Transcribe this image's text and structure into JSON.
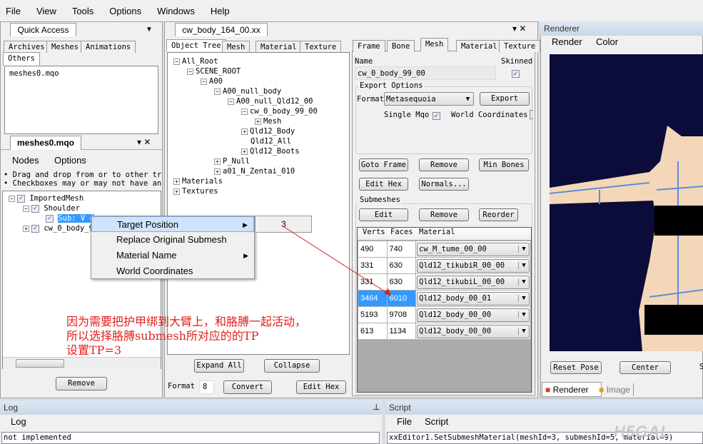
{
  "menu": [
    "File",
    "View",
    "Tools",
    "Options",
    "Windows",
    "Help"
  ],
  "quick_access": {
    "title": "Quick Access",
    "tabs": [
      "Archives",
      "Meshes",
      "Animations",
      "Others"
    ],
    "selected_tab": "Others",
    "items": [
      "meshes0.mqo"
    ]
  },
  "mesh_panel": {
    "title": "meshes0.mqo",
    "menu": [
      "Nodes",
      "Options"
    ],
    "hints": [
      "• Drag and drop from or to other tree",
      "• Checkboxes may or may not have an e"
    ],
    "tree": [
      {
        "label": "ImportedMesh",
        "level": 0,
        "checked": true,
        "expander": "-"
      },
      {
        "label": "Shoulder",
        "level": 1,
        "checked": true,
        "expander": "-"
      },
      {
        "label": "Sub: V 4",
        "level": 2,
        "checked": true,
        "expander": "",
        "selected": true
      },
      {
        "label": "cw_0_body_9",
        "level": 1,
        "checked": true,
        "expander": "+"
      }
    ],
    "remove_label": "Remove"
  },
  "context_menu": {
    "items": [
      {
        "label": "Target Position",
        "submenu": true,
        "highlighted": true
      },
      {
        "label": "Replace Original Submesh",
        "submenu": false
      },
      {
        "label": "Material Name",
        "submenu": true
      },
      {
        "label": "World Coordinates",
        "submenu": false
      }
    ],
    "submenu_value": "3"
  },
  "editor": {
    "title": "cw_body_164_00.xx",
    "tabs": [
      "Object Tree",
      "Mesh",
      "Material",
      "Texture"
    ],
    "tree": [
      {
        "label": "All_Root",
        "level": 0,
        "exp": "-"
      },
      {
        "label": "SCENE_ROOT",
        "level": 1,
        "exp": "-"
      },
      {
        "label": "A00",
        "level": 2,
        "exp": "-"
      },
      {
        "label": "A00_null_body",
        "level": 3,
        "exp": "-"
      },
      {
        "label": "A00_null_Qld12_00",
        "level": 4,
        "exp": "-"
      },
      {
        "label": "cw_0_body_99_00",
        "level": 5,
        "exp": "-"
      },
      {
        "label": "Mesh",
        "level": 6,
        "exp": "+"
      },
      {
        "label": "Qld12_Body",
        "level": 5,
        "exp": "+"
      },
      {
        "label": "Qld12_All",
        "level": 5,
        "exp": ""
      },
      {
        "label": "Qld12_Boots",
        "level": 5,
        "exp": "+"
      },
      {
        "label": "P_Null",
        "level": 3,
        "exp": "+"
      },
      {
        "label": "a01_N_Zentai_010",
        "level": 3,
        "exp": "+"
      },
      {
        "label": "Materials",
        "level": 0,
        "exp": "+"
      },
      {
        "label": "Textures",
        "level": 0,
        "exp": "+"
      }
    ],
    "expand_all": "Expand All",
    "collapse": "Collapse",
    "format_label": "Format",
    "format_value": "8",
    "convert": "Convert",
    "edit_hex": "Edit Hex"
  },
  "mesh_editor": {
    "tabs": [
      "Frame",
      "Bone",
      "Mesh",
      "Material",
      "Texture"
    ],
    "selected_tab": "Mesh",
    "name_label": "Name",
    "name_value": "cw_0_body_99_00",
    "skinned_label": "Skinned",
    "skinned": true,
    "export_options": "Export Options",
    "format_label": "Format",
    "format_value": "Metasequoia",
    "export": "Export",
    "single_mqo": "Single Mqo",
    "single_mqo_checked": true,
    "world_coordinates": "World Coordinates",
    "buttons": [
      "Goto Frame",
      "Remove",
      "Min Bones",
      "Edit Hex",
      "Normals..."
    ],
    "submeshes": "Submeshes",
    "sub_buttons": [
      "Edit",
      "Remove",
      "Reorder"
    ],
    "columns": [
      "Verts",
      "Faces",
      "Material"
    ],
    "rows": [
      {
        "verts": "490",
        "faces": "740",
        "material": "cw_M_tume_00_00"
      },
      {
        "verts": "331",
        "faces": "630",
        "material": "Qld12_tikubiR_00_00"
      },
      {
        "verts": "331",
        "faces": "630",
        "material": "Qld12_tikubiL_00_00"
      },
      {
        "verts": "3464",
        "faces": "6010",
        "material": "Qld12_body_00_01",
        "selected": true
      },
      {
        "verts": "5193",
        "faces": "9708",
        "material": "Qld12_body_00_00"
      },
      {
        "verts": "613",
        "faces": "1134",
        "material": "Qld12_body_00_00"
      }
    ]
  },
  "renderer": {
    "title": "Renderer",
    "menu": [
      "Render",
      "Color"
    ],
    "reset_pose": "Reset Pose",
    "center": "Center",
    "partial": "S",
    "tabs": [
      "Renderer",
      "Image"
    ],
    "bg_color": "#0c0c3a"
  },
  "log": {
    "title": "Log",
    "menu": "Log",
    "text": "not implemented"
  },
  "script": {
    "title": "Script",
    "menu": [
      "File",
      "Script"
    ],
    "text": "xxEditor1.SetSubmeshMaterial(meshId=3, submeshId=5, material=9)"
  },
  "annotation": {
    "lines": [
      "因为需要把护甲绑到大臂上，和胳膊一起活动，",
      "所以选择胳膊submesh所对应的的TP",
      "设置TP=3"
    ],
    "color": "#e0201c"
  },
  "watermark": "H5GAL"
}
